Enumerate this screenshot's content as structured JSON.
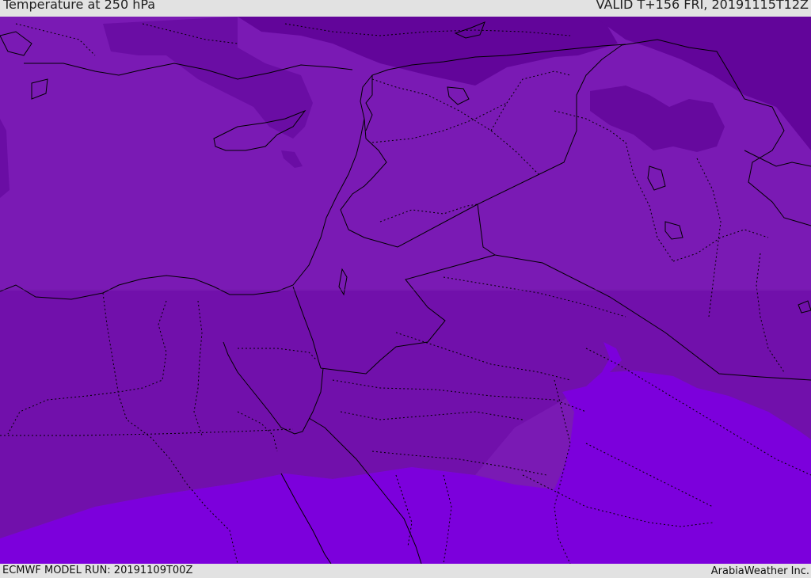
{
  "header": {
    "title": "Temperature at 250 hPa",
    "valid": "VALID T+156 FRI, 20191115T12Z"
  },
  "footer": {
    "model_run": "ECMWF MODEL RUN: 20191109T00Z",
    "credit": "ArabiaWeather Inc."
  },
  "map": {
    "colors": {
      "coldest": "#62059a",
      "cold": "#6e10a8",
      "mid": "#7a1ab4",
      "warm": "#7110ab",
      "warmest": "#7c00dc"
    }
  }
}
